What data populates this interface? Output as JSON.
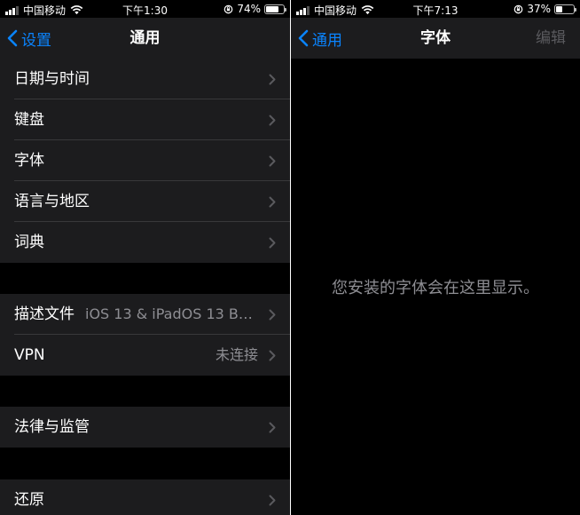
{
  "left_screen": {
    "status": {
      "carrier": "中国移动",
      "time": "下午1:30",
      "battery_pct": "74%",
      "battery_level": 0.74
    },
    "nav": {
      "back_label": "设置",
      "title": "通用"
    },
    "rows": {
      "date_time": {
        "label": "日期与时间"
      },
      "keyboard": {
        "label": "键盘"
      },
      "fonts": {
        "label": "字体"
      },
      "language_region": {
        "label": "语言与地区"
      },
      "dictionary": {
        "label": "词典"
      },
      "profile": {
        "label": "描述文件",
        "value": "iOS 13 & iPadOS 13 Bet..."
      },
      "vpn": {
        "label": "VPN",
        "value": "未连接"
      },
      "legal": {
        "label": "法律与监管"
      },
      "reset": {
        "label": "还原"
      }
    }
  },
  "right_screen": {
    "status": {
      "carrier": "中国移动",
      "time": "下午7:13",
      "battery_pct": "37%",
      "battery_level": 0.37
    },
    "nav": {
      "back_label": "通用",
      "title": "字体",
      "edit_label": "编辑"
    },
    "empty_message": "您安装的字体会在这里显示。"
  },
  "colors": {
    "accent": "#0a84ff",
    "cell_bg": "#1c1c1e",
    "background": "#000000",
    "secondary_text": "#8e8e93"
  }
}
